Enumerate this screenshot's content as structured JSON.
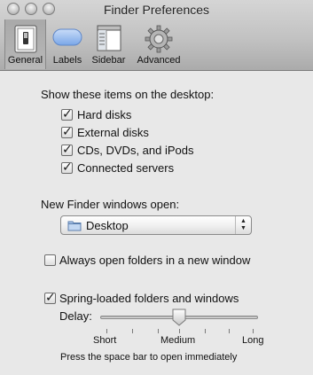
{
  "window": {
    "title": "Finder Preferences"
  },
  "toolbar": {
    "items": [
      {
        "label": "General",
        "icon": "switch-icon",
        "selected": true
      },
      {
        "label": "Labels",
        "icon": "label-pill-icon"
      },
      {
        "label": "Sidebar",
        "icon": "sidebar-window-icon"
      },
      {
        "label": "Advanced",
        "icon": "gear-icon"
      }
    ]
  },
  "desktop": {
    "heading": "Show these items on the desktop:",
    "items": [
      {
        "label": "Hard disks",
        "checked": true
      },
      {
        "label": "External disks",
        "checked": true
      },
      {
        "label": "CDs, DVDs, and iPods",
        "checked": true
      },
      {
        "label": "Connected servers",
        "checked": true
      }
    ]
  },
  "new_window": {
    "heading": "New Finder windows open:",
    "value": "Desktop"
  },
  "always_open": {
    "label": "Always open folders in a new window",
    "checked": false
  },
  "spring": {
    "label": "Spring-loaded folders and windows",
    "checked": true,
    "delay_label": "Delay:",
    "delay_level": 0.5,
    "scale": [
      "Short",
      "Medium",
      "Long"
    ],
    "hint": "Press the space bar to open immediately"
  },
  "check_mark": "✓",
  "colors": {
    "selected_toolbar": "#b0b0b0",
    "window_bg": "#e8e8e8",
    "label_blue": "#8ab4f0"
  }
}
